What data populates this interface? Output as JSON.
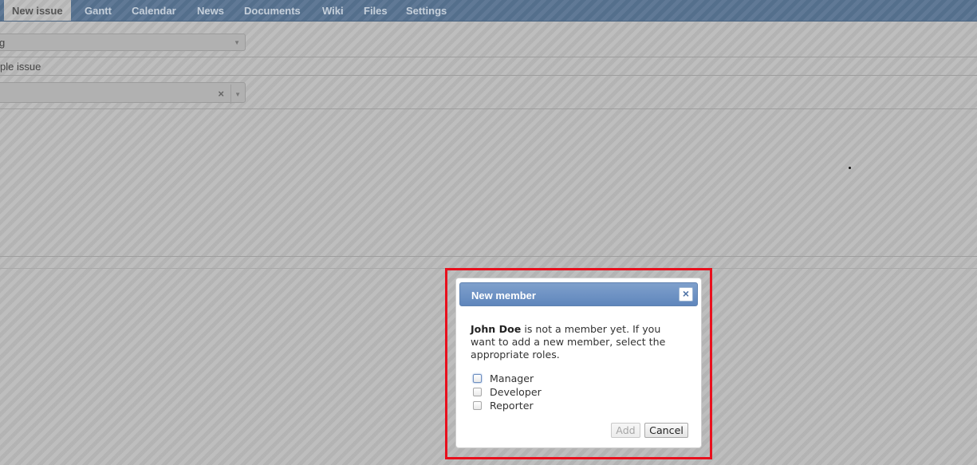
{
  "tabs": [
    {
      "label": "New issue",
      "selected": true
    },
    {
      "label": "Gantt"
    },
    {
      "label": "Calendar"
    },
    {
      "label": "News"
    },
    {
      "label": "Documents"
    },
    {
      "label": "Wiki"
    },
    {
      "label": "Files"
    },
    {
      "label": "Settings"
    }
  ],
  "background_form": {
    "select_partial_text": "g",
    "subject_partial_text": "ple issue",
    "clear_symbol": "×",
    "dropdown_symbol": "▼"
  },
  "dialog": {
    "title": "New member",
    "close_symbol": "×",
    "message": {
      "user": "John Doe",
      "text": " is not a member yet. If you want to add a new member, select the appropriate roles."
    },
    "roles": [
      {
        "label": "Manager",
        "checked": false
      },
      {
        "label": "Developer",
        "checked": false
      },
      {
        "label": "Reporter",
        "checked": false
      }
    ],
    "add_label": "Add",
    "add_disabled": true,
    "cancel_label": "Cancel"
  },
  "colors": {
    "highlight_border": "#e8101d",
    "tabbar_bg": "#56718f",
    "dialog_title_bg": "#6a8fc4"
  }
}
